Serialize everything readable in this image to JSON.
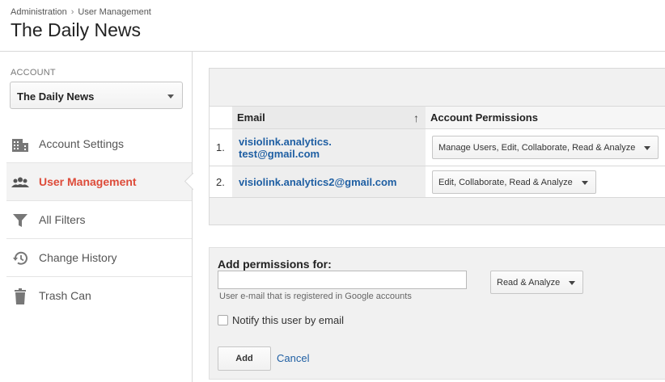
{
  "breadcrumb": {
    "items": [
      "Administration",
      "User Management"
    ],
    "separator": "›"
  },
  "page_title": "The Daily News",
  "account": {
    "label": "ACCOUNT",
    "selected": "The Daily News"
  },
  "nav": {
    "items": [
      {
        "label": "Account Settings",
        "icon": "building-icon"
      },
      {
        "label": "User Management",
        "icon": "users-icon",
        "active": true
      },
      {
        "label": "All Filters",
        "icon": "filter-icon"
      },
      {
        "label": "Change History",
        "icon": "history-icon"
      },
      {
        "label": "Trash Can",
        "icon": "trash-icon"
      }
    ]
  },
  "users_table": {
    "columns": {
      "email": "Email",
      "permissions": "Account Permissions"
    },
    "rows": [
      {
        "num": "1.",
        "email_line1": "visiolink.analytics.",
        "email_line2": "test@gmail.com",
        "permissions": "Manage Users, Edit, Collaborate, Read & Analyze"
      },
      {
        "num": "2.",
        "email_line1": "visiolink.analytics2@gmail.com",
        "email_line2": "",
        "permissions": "Edit, Collaborate, Read & Analyze"
      }
    ]
  },
  "add_permissions": {
    "title": "Add permissions for:",
    "email_value": "",
    "hint": "User e-mail that is registered in Google accounts",
    "permission": "Read & Analyze",
    "notify_label": "Notify this user by email",
    "add_label": "Add",
    "cancel_label": "Cancel"
  },
  "colors": {
    "link": "#1f5fa3",
    "active_nav": "#dd4b39",
    "panel_bg": "#f1f1f1"
  }
}
